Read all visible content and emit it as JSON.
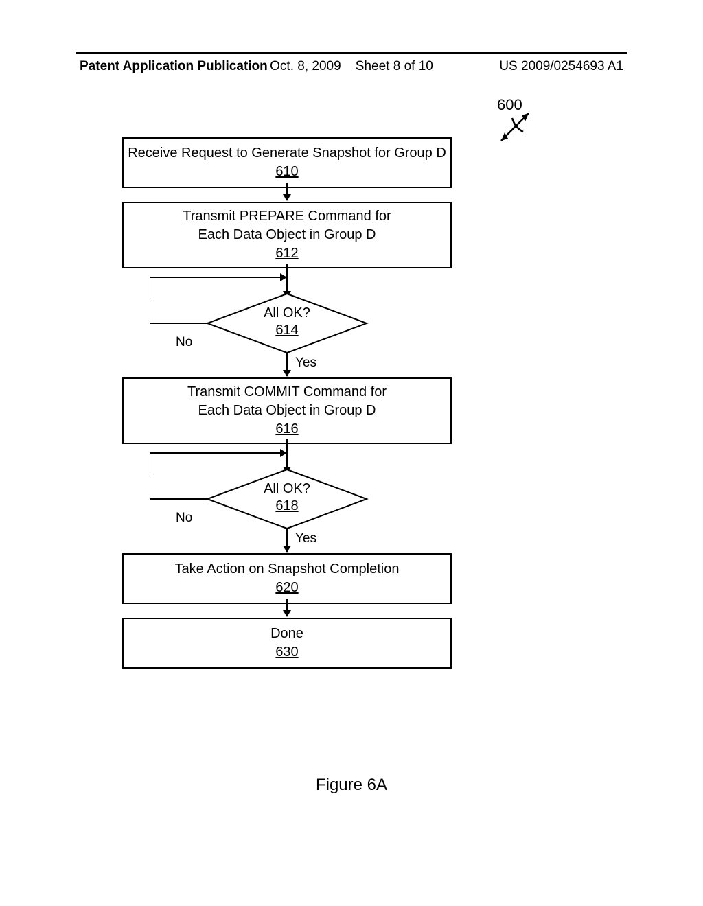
{
  "header": {
    "left": "Patent Application Publication",
    "date": "Oct. 8, 2009",
    "sheet": "Sheet 8 of 10",
    "pubno": "US 2009/0254693 A1"
  },
  "figref": "600",
  "boxes": {
    "b610": {
      "text": "Receive Request to Generate Snapshot for Group D",
      "ref": "610"
    },
    "b612": {
      "text1": "Transmit PREPARE Command for",
      "text2": "Each Data Object in Group D",
      "ref": "612"
    },
    "d614": {
      "text": "All OK?",
      "ref": "614"
    },
    "b616": {
      "text1": "Transmit COMMIT Command for",
      "text2": "Each Data Object in Group D",
      "ref": "616"
    },
    "d618": {
      "text": "All OK?",
      "ref": "618"
    },
    "b620": {
      "text": "Take Action on Snapshot Completion",
      "ref": "620"
    },
    "b630": {
      "text": "Done",
      "ref": "630"
    }
  },
  "labels": {
    "yes": "Yes",
    "no": "No"
  },
  "figcap": "Figure 6A"
}
